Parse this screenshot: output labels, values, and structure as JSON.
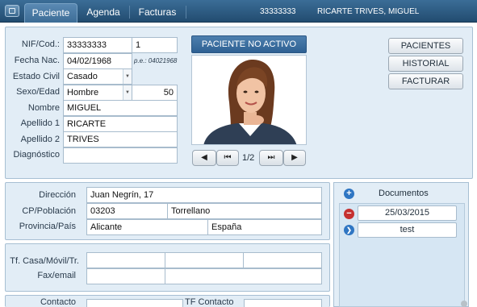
{
  "tabs": [
    {
      "label": "Paciente"
    },
    {
      "label": "Agenda"
    },
    {
      "label": "Facturas"
    }
  ],
  "header": {
    "patient_code": "33333333",
    "patient_name": "RICARTE TRIVES, MIGUEL"
  },
  "labels": {
    "nif": "NIF/Cod.:",
    "fecha_nac": "Fecha Nac.",
    "estado_civil": "Estado Civil",
    "sexo_edad": "Sexo/Edad",
    "nombre": "Nombre",
    "apellido1": "Apellido 1",
    "apellido2": "Apellido 2",
    "diagnostico": "Diagnóstico",
    "direccion": "Dirección",
    "cp_poblacion": "CP/Población",
    "provincia_pais": "Provincia/País",
    "telefonos": "Tf. Casa/Móvil/Tr.",
    "fax_email": "Fax/email",
    "contacto": "Contacto",
    "tf_contacto": "TF Contacto"
  },
  "patient": {
    "nif": "33333333",
    "cod": "1",
    "fecha_nac": "04/02/1968",
    "fecha_hint": "p.e.: 04021968",
    "estado_civil": "Casado",
    "sexo": "Hombre",
    "edad": "50",
    "nombre": "MIGUEL",
    "apellido1": "RICARTE",
    "apellido2": "TRIVES",
    "diagnostico": "",
    "direccion": "Juan Negrín, 17",
    "cp": "03203",
    "poblacion": "Torrellano",
    "provincia": "Alicante",
    "pais": "España"
  },
  "status_button": "PACIENTE NO ACTIVO",
  "photo_nav": {
    "counter": "1/2"
  },
  "side_buttons": {
    "pacientes": "PACIENTES",
    "historial": "HISTORIAL",
    "facturar": "FACTURAR"
  },
  "documents": {
    "title": "Documentos",
    "items": [
      {
        "label": "25/03/2015"
      },
      {
        "label": "test"
      }
    ]
  },
  "colors": {
    "accent": "#2f6193",
    "tabbar": "#2c5a80",
    "panel": "#e2edf6"
  }
}
